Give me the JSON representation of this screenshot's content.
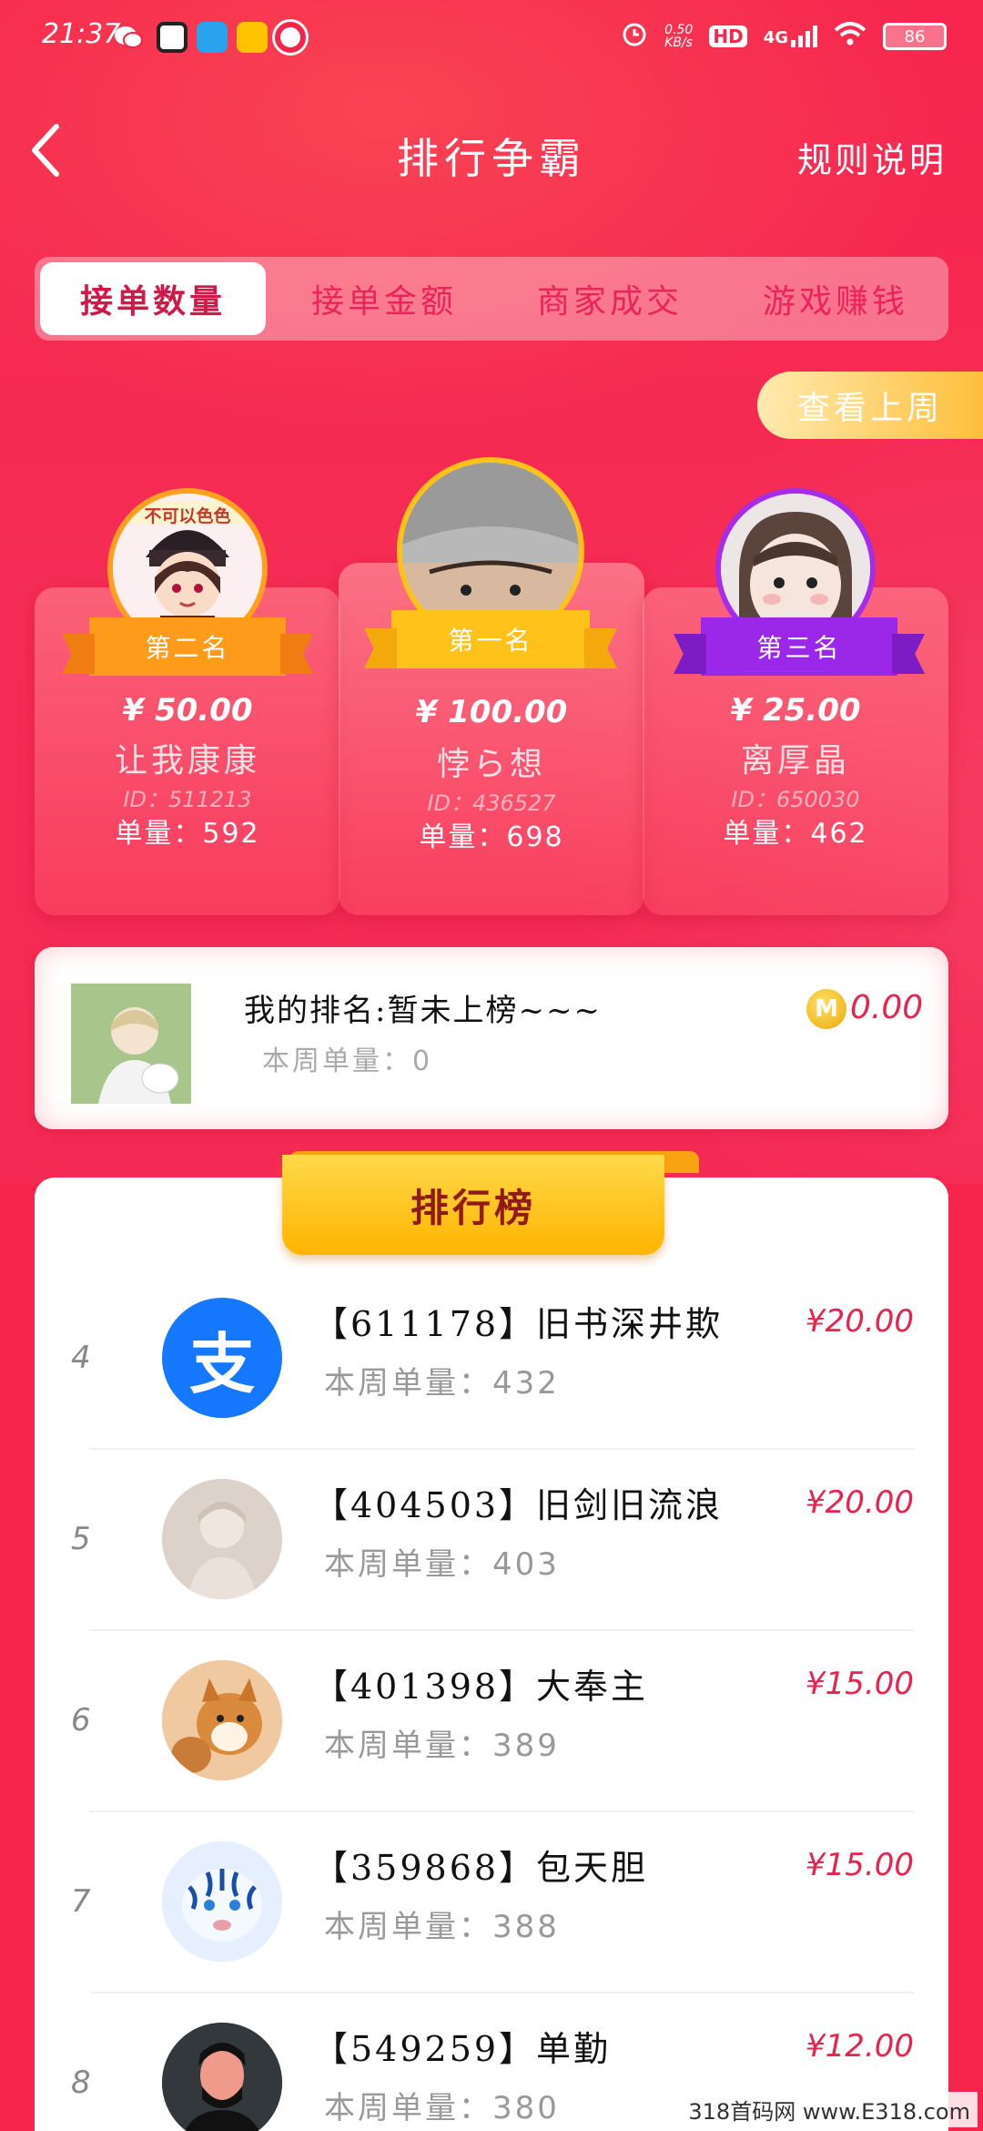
{
  "status_bar": {
    "time": "21:37",
    "net_speed": "0.50",
    "net_unit": "KB/s",
    "hd": "HD",
    "signal": "4G",
    "battery": "86"
  },
  "header": {
    "title": "排行争霸",
    "rules": "规则说明"
  },
  "tabs": [
    {
      "label": "接单数量",
      "active": true
    },
    {
      "label": "接单金额",
      "active": false
    },
    {
      "label": "商家成交",
      "active": false
    },
    {
      "label": "游戏赚钱",
      "active": false
    }
  ],
  "last_week_button": "查看上周",
  "podium": {
    "second": {
      "badge": "第二名",
      "amount": "¥ 50.00",
      "name": "让我康康",
      "id": "ID：511213",
      "count": "单量：592"
    },
    "first": {
      "badge": "第一名",
      "amount": "¥ 100.00",
      "name": "悖ら想",
      "id": "ID：436527",
      "count": "单量：698"
    },
    "third": {
      "badge": "第三名",
      "amount": "¥ 25.00",
      "name": "离厚晶",
      "id": "ID：650030",
      "count": "单量：462"
    }
  },
  "avatar_texts": {
    "second_sign": "不可以色色"
  },
  "my_rank": {
    "title": "我的排名:暂未上榜~~~",
    "count": "本周单量：0",
    "coin": "M",
    "amount": "0.00"
  },
  "board": {
    "title": "排行榜",
    "rows": [
      {
        "rank": "4",
        "title": "【611178】旧书深井欺",
        "count": "本周单量：432",
        "amount": "¥20.00",
        "avatar": "alipay-icon",
        "avatar_glyph": "支"
      },
      {
        "rank": "5",
        "title": "【404503】旧剑旧流浪",
        "count": "本周单量：403",
        "amount": "¥20.00",
        "avatar": "anime-boy-avatar"
      },
      {
        "rank": "6",
        "title": "【401398】大奉主",
        "count": "本周单量：389",
        "amount": "¥15.00",
        "avatar": "shiba-dog-avatar"
      },
      {
        "rank": "7",
        "title": "【359868】包天胆",
        "count": "本周单量：388",
        "amount": "¥15.00",
        "avatar": "tiger-avatar"
      },
      {
        "rank": "8",
        "title": "【549259】单勤",
        "count": "本周单量：380",
        "amount": "¥12.00",
        "avatar": "man-avatar"
      }
    ]
  },
  "watermark": "318首码网 www.E318.com",
  "colors": {
    "background": "#f4244b",
    "accent_red": "#e8234e",
    "gold": "#ffc21a",
    "purple": "#9b27e8",
    "orange": "#ff9b1a"
  }
}
